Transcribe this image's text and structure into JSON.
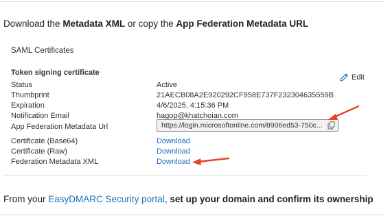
{
  "instructions": {
    "step1": {
      "prefix": "Download the ",
      "bold1": "Metadata XML",
      "middle": " or copy the ",
      "bold2": "App Federation Metadata URL"
    },
    "step2": {
      "prefix": "From your ",
      "link": "EasyDMARC Security portal",
      "middle": ",  ",
      "bold": "set up your domain and confirm its ownership"
    }
  },
  "saml": {
    "section_title": "SAML Certificates",
    "token_heading": "Token signing certificate",
    "edit_label": "Edit",
    "rows": [
      {
        "label": "Status",
        "value": "Active"
      },
      {
        "label": "Thumbprint",
        "value": "21AECB08A2E920292CF958E737F232304635559B"
      },
      {
        "label": "Expiration",
        "value": "4/6/2025, 4:15:36 PM"
      },
      {
        "label": "Notification Email",
        "value": "hagop@khatchoian.com"
      },
      {
        "label": "App Federation Metadata Url",
        "value": "https://login.microsoftonline.com/8906ed53-750c..."
      },
      {
        "label": "Certificate (Base64)",
        "value": "Download"
      },
      {
        "label": "Certificate (Raw)",
        "value": "Download"
      },
      {
        "label": "Federation Metadata XML",
        "value": "Download"
      }
    ]
  },
  "colors": {
    "link": "#1a6bc4",
    "annotation_arrow": "#e8412c"
  },
  "icons": {
    "edit": "pencil-icon",
    "copy": "copy-icon",
    "annotation": "red-arrow-icon"
  }
}
